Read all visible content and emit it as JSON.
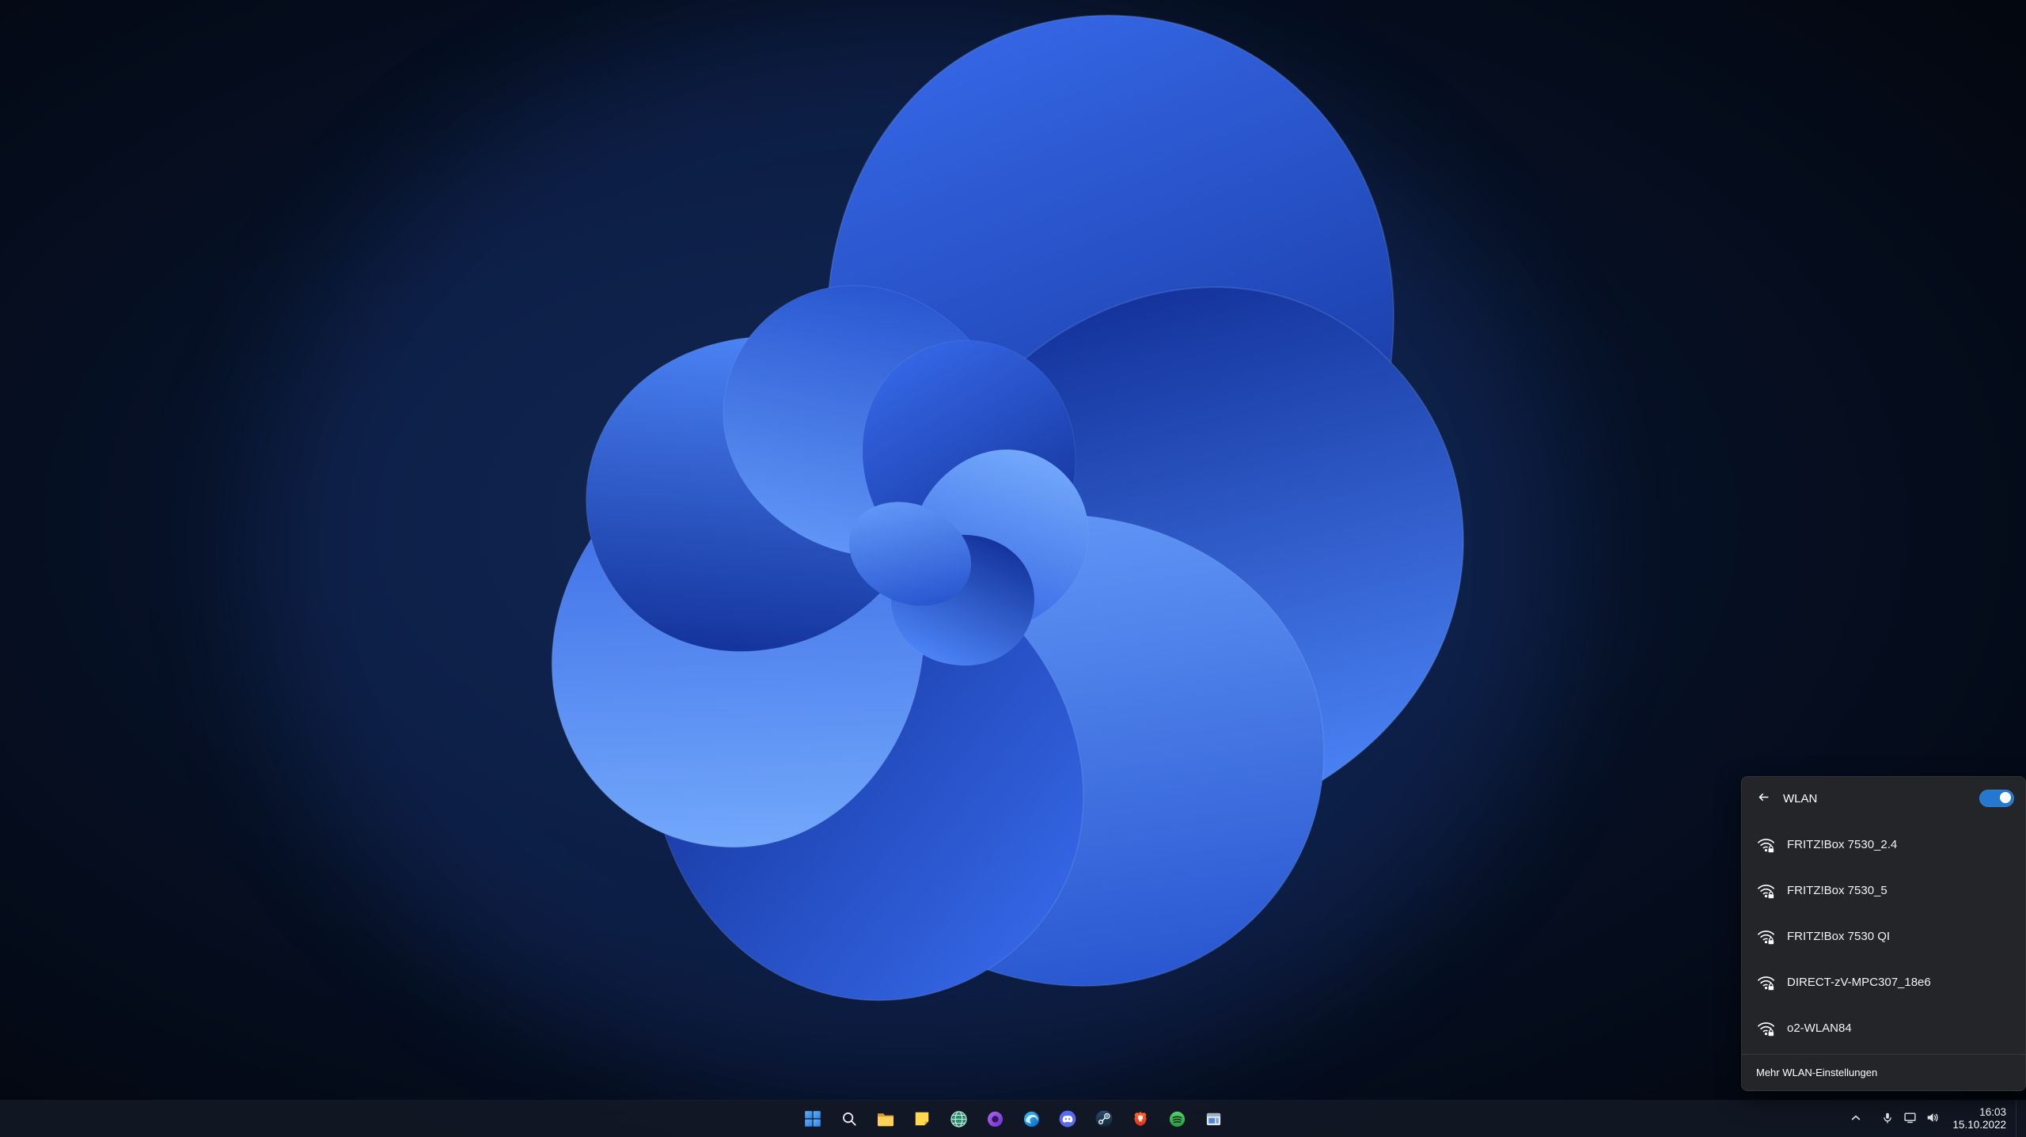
{
  "wallpaper": {
    "description": "windows-11-blue-bloom-dark",
    "background_color": "#050b16",
    "bloom_colors": [
      "#0f2f96",
      "#2c5ae0",
      "#4b83f5",
      "#7db4ff"
    ]
  },
  "wifi_flyout": {
    "title": "WLAN",
    "toggle_on": true,
    "accent_color": "#2577cf",
    "back_icon": "back-arrow-icon",
    "networks": [
      {
        "name": "FRITZ!Box 7530_2.4",
        "icon": "wifi-lock-icon"
      },
      {
        "name": "FRITZ!Box 7530_5",
        "icon": "wifi-lock-icon"
      },
      {
        "name": "FRITZ!Box 7530 QI",
        "icon": "wifi-lock-icon"
      },
      {
        "name": "DIRECT-zV-MPC307_18e6",
        "icon": "wifi-lock-icon"
      },
      {
        "name": "o2-WLAN84",
        "icon": "wifi-lock-icon"
      }
    ],
    "footer_link": "Mehr WLAN-Einstellungen"
  },
  "taskbar": {
    "app_icons": [
      "windows-start-icon",
      "search-icon",
      "file-explorer-icon",
      "sticky-note-icon",
      "globe-app-icon",
      "purple-app-icon",
      "edge-browser-icon",
      "discord-icon",
      "steam-icon",
      "brave-icon",
      "green-app-icon",
      "app-window-icon"
    ],
    "tray_icons": [
      "chevron-up-icon",
      "microphone-icon",
      "network-icon",
      "volume-icon"
    ],
    "tray": {
      "time": "16:03",
      "date": "15.10.2022"
    }
  }
}
